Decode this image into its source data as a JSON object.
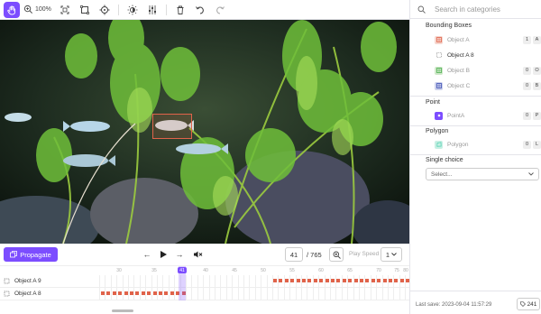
{
  "toolbar": {
    "zoom_level": "100%",
    "tools": [
      "pan-icon",
      "zoom-icon",
      "crop-icon",
      "transform-icon",
      "crosshair-icon",
      "brightness-icon",
      "adjust-icon",
      "delete-icon",
      "undo-icon",
      "redo-icon"
    ]
  },
  "sidebar": {
    "search_placeholder": "Search in categories",
    "groups": {
      "bounding_boxes": {
        "title": "Bounding Boxes",
        "items": [
          {
            "label": "Object A",
            "key": "1",
            "key2": "A",
            "color": "#e0634a"
          },
          {
            "label": "Object A 8",
            "key": "",
            "key2": "",
            "color": "#888888"
          },
          {
            "label": "Object B",
            "key": "0",
            "key2": "O",
            "color": "#4caf50"
          },
          {
            "label": "Object C",
            "key": "0",
            "key2": "B",
            "color": "#3f51b5"
          }
        ]
      },
      "point": {
        "title": "Point",
        "items": [
          {
            "label": "PointA",
            "key": "0",
            "key2": "P",
            "color": "#7c4dff"
          }
        ]
      },
      "polygon": {
        "title": "Polygon",
        "items": [
          {
            "label": "Polygon",
            "key": "0",
            "key2": "L",
            "color": "#4dd0b1"
          }
        ]
      },
      "single_choice": {
        "title": "Single choice",
        "select_value": "Select..."
      }
    },
    "last_save": "Last save: 2023-09-04 11:57:29",
    "count": "241"
  },
  "controls": {
    "propagate_label": "Propagate",
    "current_frame": "41",
    "total_frames": "/ 765",
    "play_speed_label": "Play Speed",
    "play_speed_value": "1"
  },
  "timeline": {
    "ticks": [
      "30",
      "35",
      "41",
      "40",
      "45",
      "50",
      "55",
      "60",
      "65",
      "70",
      "75",
      "80"
    ],
    "playhead_frame": "41",
    "tracks": [
      {
        "label": "Object A 9"
      },
      {
        "label": "Object A 8"
      }
    ]
  }
}
